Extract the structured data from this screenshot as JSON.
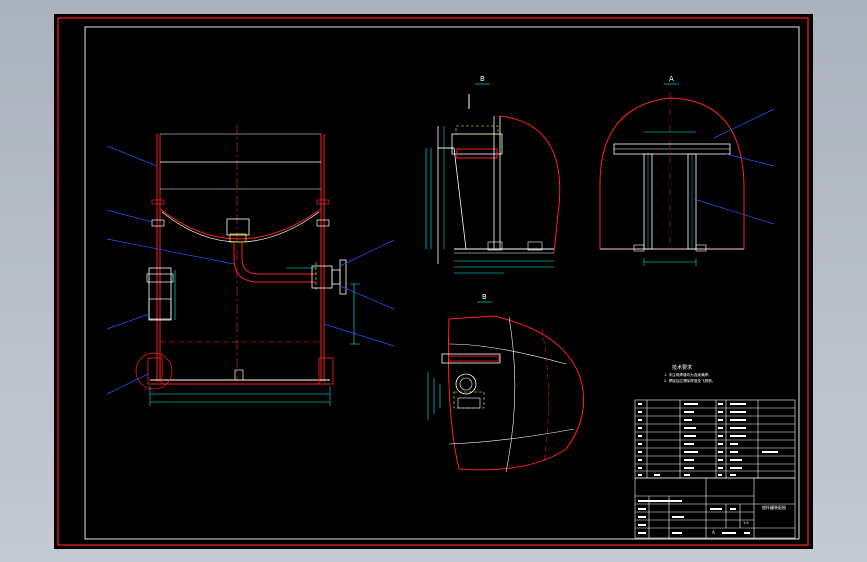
{
  "drawing": {
    "notes_title": "技术要求",
    "notes_lines": [
      "1. 未注明焊缝均为连续满焊。",
      "2. 焊接后应清除焊渣及飞溅物。"
    ],
    "drawing_title": "搅拌罐装配图",
    "scale": "1:5",
    "sheet_label": "A",
    "section_labels": [
      "B",
      "A",
      "B"
    ]
  },
  "colors": {
    "frame": "#ff2020",
    "outline": "#ffffff",
    "centerline": "#ff2020",
    "dimension": "#00ffff",
    "hidden": "#ffff00",
    "leader": "#3050ff",
    "notes": "#00ff40",
    "parts": "#ffffff"
  }
}
